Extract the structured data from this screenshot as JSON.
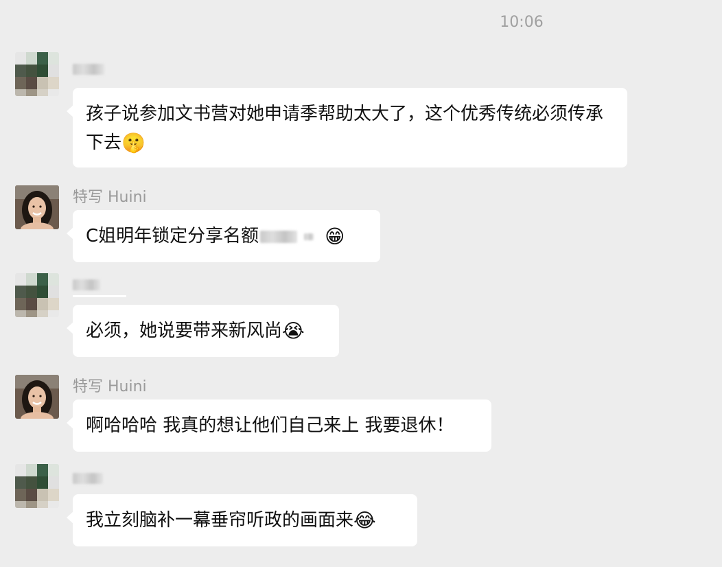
{
  "chat": {
    "timestamp": "10:06",
    "messages": [
      {
        "sender": "",
        "text": "孩子说参加文书营对她申请季帮助太大了，这个优秀传统必须传承下去",
        "emoji": "🤫"
      },
      {
        "sender": "特写 Huini",
        "text": "C姐明年锁定分享名额",
        "emoji": "😁"
      },
      {
        "sender": "",
        "text": "必须，她说要带来新风尚",
        "emoji": "😭"
      },
      {
        "sender": "特写 Huini",
        "text": "啊哈哈哈 我真的想让他们自己来上 我要退休！",
        "emoji": ""
      },
      {
        "sender": "",
        "text": "我立刻脑补一幕垂帘听政的画面来",
        "emoji": "😂"
      }
    ]
  },
  "colors": {
    "background": "#ededed",
    "bubble": "#ffffff",
    "sender_text": "#9a9a9a",
    "timestamp_text": "#a0a0a0"
  }
}
